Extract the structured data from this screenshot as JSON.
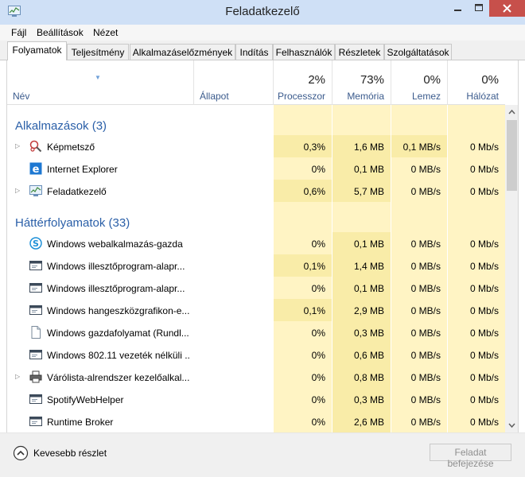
{
  "window": {
    "title": "Feladatkezelő"
  },
  "menu": [
    "Fájl",
    "Beállítások",
    "Nézet"
  ],
  "tabs": [
    "Folyamatok",
    "Teljesítmény",
    "Alkalmazáselőzmények",
    "Indítás",
    "Felhasználók",
    "Részletek",
    "Szolgáltatások"
  ],
  "columns": {
    "name": "Név",
    "status": "Állapot",
    "cpu": {
      "pct": "2%",
      "label": "Processzor"
    },
    "memory": {
      "pct": "73%",
      "label": "Memória"
    },
    "disk": {
      "pct": "0%",
      "label": "Lemez"
    },
    "network": {
      "pct": "0%",
      "label": "Hálózat"
    }
  },
  "groups": {
    "apps": "Alkalmazások (3)",
    "background": "Háttérfolyamatok (33)"
  },
  "apps": [
    {
      "name": "Képmetsző",
      "cpu": "0,3%",
      "mem": "1,6 MB",
      "disk": "0,1 MB/s",
      "net": "0 Mb/s",
      "icon": "snipping-tool-icon"
    },
    {
      "name": "Internet Explorer",
      "cpu": "0%",
      "mem": "0,1 MB",
      "disk": "0 MB/s",
      "net": "0 Mb/s",
      "icon": "internet-explorer-icon"
    },
    {
      "name": "Feladatkezelő",
      "cpu": "0,6%",
      "mem": "5,7 MB",
      "disk": "0 MB/s",
      "net": "0 Mb/s",
      "icon": "task-manager-icon"
    }
  ],
  "background": [
    {
      "name": "Windows webalkalmazás-gazda",
      "cpu": "0%",
      "mem": "0,1 MB",
      "disk": "0 MB/s",
      "net": "0 Mb/s",
      "icon": "skype-icon"
    },
    {
      "name": "Windows illesztőprogram-alapr...",
      "cpu": "0,1%",
      "mem": "1,4 MB",
      "disk": "0 MB/s",
      "net": "0 Mb/s",
      "icon": "window-app-icon"
    },
    {
      "name": "Windows illesztőprogram-alapr...",
      "cpu": "0%",
      "mem": "0,1 MB",
      "disk": "0 MB/s",
      "net": "0 Mb/s",
      "icon": "window-app-icon"
    },
    {
      "name": "Windows hangeszközgrafikon-e...",
      "cpu": "0,1%",
      "mem": "2,9 MB",
      "disk": "0 MB/s",
      "net": "0 Mb/s",
      "icon": "window-app-icon"
    },
    {
      "name": "Windows gazdafolyamat (Rundl...",
      "cpu": "0%",
      "mem": "0,3 MB",
      "disk": "0 MB/s",
      "net": "0 Mb/s",
      "icon": "document-icon"
    },
    {
      "name": "Windows 802.11 vezeték nélküli ...",
      "cpu": "0%",
      "mem": "0,6 MB",
      "disk": "0 MB/s",
      "net": "0 Mb/s",
      "icon": "window-app-icon"
    },
    {
      "name": "Várólista-alrendszer kezelőalkal...",
      "cpu": "0%",
      "mem": "0,8 MB",
      "disk": "0 MB/s",
      "net": "0 Mb/s",
      "icon": "printer-icon"
    },
    {
      "name": "SpotifyWebHelper",
      "cpu": "0%",
      "mem": "0,3 MB",
      "disk": "0 MB/s",
      "net": "0 Mb/s",
      "icon": "window-app-icon"
    },
    {
      "name": "Runtime Broker",
      "cpu": "0%",
      "mem": "2,6 MB",
      "disk": "0 MB/s",
      "net": "0 Mb/s",
      "icon": "window-app-icon"
    }
  ],
  "footer": {
    "fewer_details": "Kevesebb részlet",
    "end_task": "Feladat befejezése"
  },
  "colors": {
    "titlebar": "#cfe0f6",
    "close": "#c7504b",
    "heat_light": "#fff4c4",
    "heat_medium": "#f9eca8",
    "group_text": "#2a5fa8"
  }
}
